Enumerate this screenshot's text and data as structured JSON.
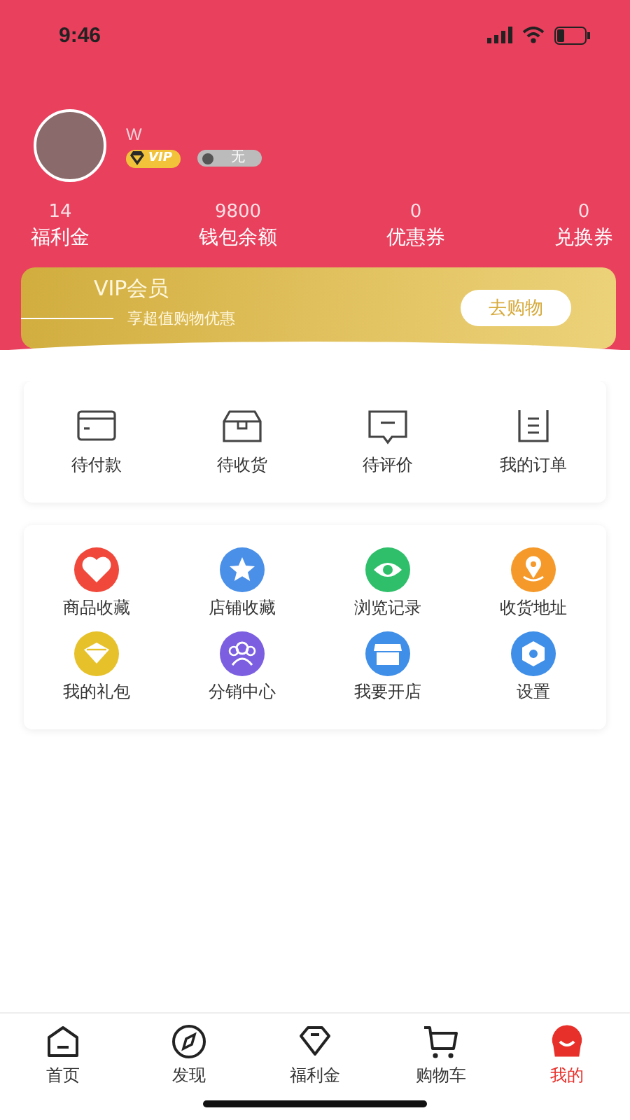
{
  "status_bar": {
    "time": "9:46"
  },
  "profile": {
    "name": "W",
    "vip_badge": "VIP",
    "level_tag": "无"
  },
  "stats": [
    {
      "value": "14",
      "label": "福利金"
    },
    {
      "value": "9800",
      "label": "钱包余额"
    },
    {
      "value": "0",
      "label": "优惠券"
    },
    {
      "value": "0",
      "label": "兑换券"
    }
  ],
  "vip_card": {
    "title": "VIP会员",
    "subtitle": "享超值购物优惠",
    "button": "去购物"
  },
  "orders": [
    {
      "kind": "card",
      "label": "待付款"
    },
    {
      "kind": "box",
      "label": "待收货"
    },
    {
      "kind": "comment",
      "label": "待评价"
    },
    {
      "kind": "list",
      "label": "我的订单"
    }
  ],
  "services": [
    {
      "kind": "heart",
      "label": "商品收藏",
      "color": "#f0483a"
    },
    {
      "kind": "star",
      "label": "店铺收藏",
      "color": "#4a90e8"
    },
    {
      "kind": "eye",
      "label": "浏览记录",
      "color": "#2fbf6a"
    },
    {
      "kind": "pin",
      "label": "收货地址",
      "color": "#f59a2a"
    },
    {
      "kind": "gem",
      "label": "我的礼包",
      "color": "#e6c12a"
    },
    {
      "kind": "people",
      "label": "分销中心",
      "color": "#7b5fe0"
    },
    {
      "kind": "shop",
      "label": "我要开店",
      "color": "#3f8ee8"
    },
    {
      "kind": "gear",
      "label": "设置",
      "color": "#3f8ee8"
    }
  ],
  "tab_bar": [
    {
      "kind": "home",
      "label": "首页",
      "selected": false
    },
    {
      "kind": "compass",
      "label": "发现",
      "selected": false
    },
    {
      "kind": "diamond",
      "label": "福利金",
      "selected": false
    },
    {
      "kind": "cart",
      "label": "购物车",
      "selected": false
    },
    {
      "kind": "me",
      "label": "我的",
      "selected": true
    }
  ]
}
